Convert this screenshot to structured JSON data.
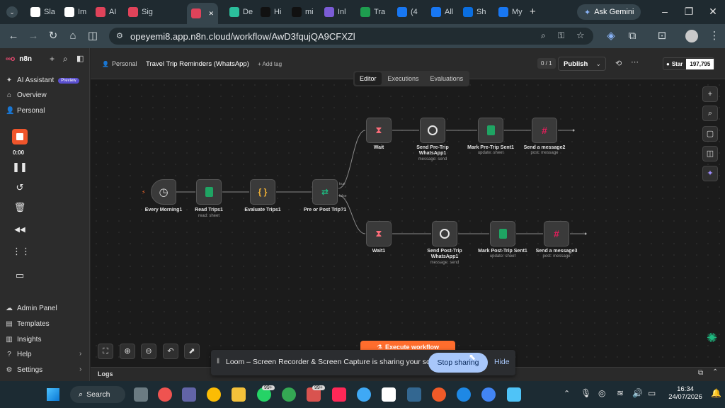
{
  "browser": {
    "tabs": [
      {
        "label": "Sla",
        "color": "#ffffff"
      },
      {
        "label": "Im",
        "color": "#ffffff"
      },
      {
        "label": "AI",
        "color": "#e0435a"
      },
      {
        "label": "Sig",
        "color": "#e0435a"
      },
      {
        "label": "",
        "color": "#e0435a",
        "active": true
      },
      {
        "label": "De",
        "color": "#2bbf9c"
      },
      {
        "label": "Hi",
        "color": "#111111"
      },
      {
        "label": "mi",
        "color": "#111111"
      },
      {
        "label": "Inl",
        "color": "#7b5cd6"
      },
      {
        "label": "Tra",
        "color": "#1e9e4f"
      },
      {
        "label": "(4",
        "color": "#1877f2"
      },
      {
        "label": "All",
        "color": "#1877f2"
      },
      {
        "label": "Sh",
        "color": "#0a6ee0"
      },
      {
        "label": "My",
        "color": "#1877f2"
      }
    ],
    "ask_gemini": "Ask Gemini",
    "url": "opeyemi8.app.n8n.cloud/workflow/AwD3fqujQA9CFXZl"
  },
  "app": {
    "brand": "n8n",
    "sidebar": {
      "ai_assistant": "AI Assistant",
      "preview_badge": "Preview",
      "overview": "Overview",
      "personal": "Personal",
      "admin_panel": "Admin Panel",
      "templates": "Templates",
      "insights": "Insights",
      "help": "Help",
      "settings": "Settings"
    },
    "loom": {
      "timer": "0:00"
    },
    "header": {
      "project": "Personal",
      "workflow_name": "Travel Trip Reminders (WhatsApp)",
      "add_tag": "+ Add tag",
      "version": "0 / 1",
      "publish": "Publish",
      "star": "Star",
      "star_count": "197,795"
    },
    "view_tabs": {
      "editor": "Editor",
      "executions": "Executions",
      "evaluations": "Evaluations"
    },
    "nodes": {
      "every_morning": "Every Morning1",
      "read_trips": "Read Trips1",
      "read_trips_sub": "read: sheet",
      "evaluate_trips": "Evaluate Trips1",
      "pre_or_post": "Pre or Post Trip?1",
      "true_label": "true",
      "false_label": "false",
      "wait": "Wait",
      "send_pre": "Send Pre-Trip WhatsApp1",
      "send_pre_sub": "message: send",
      "mark_pre": "Mark Pre-Trip Sent1",
      "mark_pre_sub": "update: sheet",
      "send_msg2": "Send a message2",
      "send_msg2_sub": "post: message",
      "wait1": "Wait1",
      "send_post": "Send Post-Trip WhatsApp1",
      "send_post_sub": "message: send",
      "mark_post": "Mark Post-Trip Sent1",
      "mark_post_sub": "update: sheet",
      "send_msg3": "Send a message3",
      "send_msg3_sub": "post: message"
    },
    "execute_button": "Execute workflow",
    "logs": "Logs"
  },
  "sharebar": {
    "message": "Loom – Screen Recorder & Screen Capture is sharing your screen.",
    "stop": "Stop sharing",
    "hide": "Hide"
  },
  "taskbar": {
    "search": "Search",
    "badge1": "99+",
    "badge2": "99+",
    "time": "16:34",
    "date": "24/07/2026"
  },
  "colors": {
    "n8n_brand": "#ea4b71",
    "loom_record": "#f0552b",
    "execute": "#ff6d2d",
    "whatsapp": "#25d366",
    "sheets": "#1fa463",
    "wait": "#ff6d7a",
    "code": "#f2b134",
    "switch": "#1eb980"
  }
}
